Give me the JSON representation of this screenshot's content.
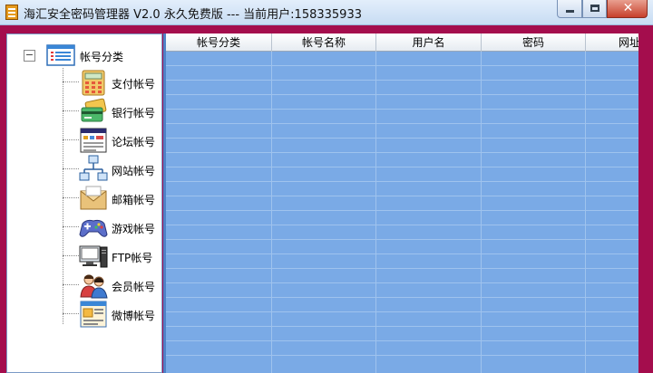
{
  "window": {
    "title": "海汇安全密码管理器 V2.0 永久免费版 --- 当前用户:158335933",
    "min_glyph": "",
    "max_glyph": "",
    "close_glyph": "✕"
  },
  "tree": {
    "expander": "−",
    "root": {
      "label": "帐号分类",
      "icon": "list-window-icon"
    },
    "items": [
      {
        "label": "支付帐号",
        "icon": "calculator-icon"
      },
      {
        "label": "银行帐号",
        "icon": "bank-cards-icon"
      },
      {
        "label": "论坛帐号",
        "icon": "forum-window-icon"
      },
      {
        "label": "网站帐号",
        "icon": "network-icon"
      },
      {
        "label": "邮箱帐号",
        "icon": "envelope-icon"
      },
      {
        "label": "游戏帐号",
        "icon": "gamepad-icon"
      },
      {
        "label": "FTP帐号",
        "icon": "computer-icon"
      },
      {
        "label": "会员帐号",
        "icon": "members-icon"
      },
      {
        "label": "微博帐号",
        "icon": "notes-window-icon"
      }
    ]
  },
  "grid": {
    "columns": [
      "帐号分类",
      "帐号名称",
      "用户名",
      "密码",
      "网址"
    ],
    "row_count": 21
  },
  "colors": {
    "frame": "#a40d4d",
    "grid_fill": "#7aaae6",
    "grid_lines": "#9fc3ee"
  }
}
